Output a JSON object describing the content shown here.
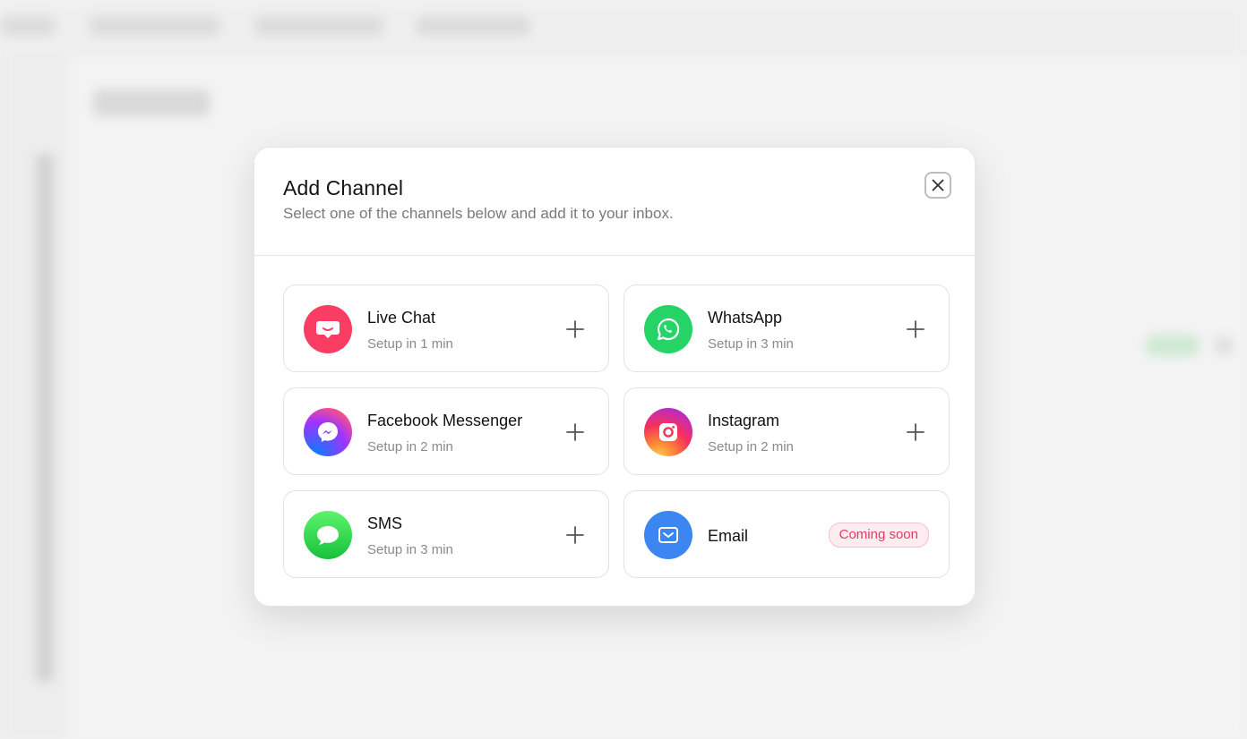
{
  "modal": {
    "title": "Add Channel",
    "subtitle": "Select one of the channels below and add it to your inbox.",
    "close_icon": "close-icon"
  },
  "channels": [
    {
      "name": "Live Chat",
      "setup": "Setup in 1 min",
      "icon": "live-chat-icon",
      "color": "#fa3e63",
      "action": "plus-icon"
    },
    {
      "name": "WhatsApp",
      "setup": "Setup in 3 min",
      "icon": "whatsapp-icon",
      "color": "#25d366",
      "action": "plus-icon"
    },
    {
      "name": "Facebook Messenger",
      "setup": "Setup in 2 min",
      "icon": "messenger-icon",
      "color": "#a033ff",
      "action": "plus-icon"
    },
    {
      "name": "Instagram",
      "setup": "Setup in 2 min",
      "icon": "instagram-icon",
      "color": "#f6305b",
      "action": "plus-icon"
    },
    {
      "name": "SMS",
      "setup": "Setup in 3 min",
      "icon": "sms-icon",
      "color": "#18c13a",
      "action": "plus-icon"
    },
    {
      "name": "Email",
      "badge": "Coming soon",
      "icon": "email-icon",
      "color": "#3b86f0"
    }
  ],
  "colors": {
    "badge_text": "#e23b66",
    "badge_bg": "#fdecf0"
  }
}
